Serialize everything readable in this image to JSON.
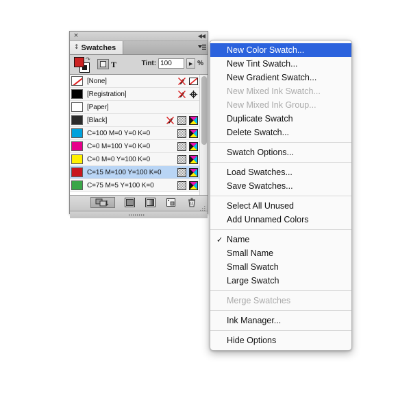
{
  "panel": {
    "close_icon": "×",
    "collapse_icon": "◀◀",
    "tab_label": "Swatches",
    "tab_dock_icon": "dock-arrows-icon",
    "menu_button_icon": "panel-menu-icon",
    "fill_color": "#cc2222",
    "stroke_color": "#ffffff",
    "tint": {
      "label": "Tint:",
      "value": "100",
      "placeholder": "100",
      "unit": "%",
      "stepper_icon": "▶"
    },
    "target_buttons": {
      "frame_label": "frame-target-icon",
      "text_label": "T"
    },
    "footer": {
      "show_all_label": "show-all-swatches-button",
      "new_color_group_label": "new-color-group-button",
      "new_gradient_label": "new-gradient-swatch-button",
      "new_swatch_label": "new-swatch-button",
      "delete_label": "delete-swatch-button"
    },
    "grip_dots": "▪▪▪▪▪▪"
  },
  "swatches": [
    {
      "name": "[None]",
      "color": "none",
      "selected": false,
      "icons": [
        "pen-x-icon",
        "none-icon"
      ]
    },
    {
      "name": "[Registration]",
      "color": "#000000",
      "selected": false,
      "icons": [
        "pen-x-icon",
        "registration-icon"
      ]
    },
    {
      "name": "[Paper]",
      "color": "#ffffff",
      "selected": false,
      "icons": []
    },
    {
      "name": "[Black]",
      "color": "#2b2b2b",
      "selected": false,
      "icons": [
        "pen-x-icon",
        "grid-icon",
        "cmyk-icon"
      ]
    },
    {
      "name": "C=100 M=0 Y=0 K=0",
      "color": "#00a2dd",
      "selected": false,
      "icons": [
        "grid-icon",
        "cmyk-icon"
      ]
    },
    {
      "name": "C=0 M=100 Y=0 K=0",
      "color": "#e6008b",
      "selected": false,
      "icons": [
        "grid-icon",
        "cmyk-icon"
      ]
    },
    {
      "name": "C=0 M=0 Y=100 K=0",
      "color": "#fff000",
      "selected": false,
      "icons": [
        "grid-icon",
        "cmyk-icon"
      ]
    },
    {
      "name": "C=15 M=100 Y=100 K=0",
      "color": "#c8161d",
      "selected": true,
      "icons": [
        "grid-icon",
        "cmyk-icon"
      ]
    },
    {
      "name": "C=75 M=5 Y=100 K=0",
      "color": "#3aa648",
      "selected": false,
      "icons": [
        "grid-icon",
        "cmyk-icon"
      ]
    }
  ],
  "context_menu": {
    "highlight_color": "#2b62dd",
    "items": [
      {
        "label": "New Color Swatch...",
        "state": "highlighted",
        "checked": false
      },
      {
        "label": "New Tint Swatch...",
        "state": "normal",
        "checked": false
      },
      {
        "label": "New Gradient Swatch...",
        "state": "normal",
        "checked": false
      },
      {
        "label": "New Mixed Ink Swatch...",
        "state": "disabled",
        "checked": false
      },
      {
        "label": "New Mixed Ink Group...",
        "state": "disabled",
        "checked": false
      },
      {
        "label": "Duplicate Swatch",
        "state": "normal",
        "checked": false
      },
      {
        "label": "Delete Swatch...",
        "state": "normal",
        "checked": false
      },
      {
        "separator": true
      },
      {
        "label": "Swatch Options...",
        "state": "normal",
        "checked": false
      },
      {
        "separator": true
      },
      {
        "label": "Load Swatches...",
        "state": "normal",
        "checked": false
      },
      {
        "label": "Save Swatches...",
        "state": "normal",
        "checked": false
      },
      {
        "separator": true
      },
      {
        "label": "Select All Unused",
        "state": "normal",
        "checked": false
      },
      {
        "label": "Add Unnamed Colors",
        "state": "normal",
        "checked": false
      },
      {
        "separator": true
      },
      {
        "label": "Name",
        "state": "normal",
        "checked": true
      },
      {
        "label": "Small Name",
        "state": "normal",
        "checked": false
      },
      {
        "label": "Small Swatch",
        "state": "normal",
        "checked": false
      },
      {
        "label": "Large Swatch",
        "state": "normal",
        "checked": false
      },
      {
        "separator": true
      },
      {
        "label": "Merge Swatches",
        "state": "disabled",
        "checked": false
      },
      {
        "separator": true
      },
      {
        "label": "Ink Manager...",
        "state": "normal",
        "checked": false
      },
      {
        "separator": true
      },
      {
        "label": "Hide Options",
        "state": "normal",
        "checked": false
      }
    ],
    "check_glyph": "✓"
  }
}
